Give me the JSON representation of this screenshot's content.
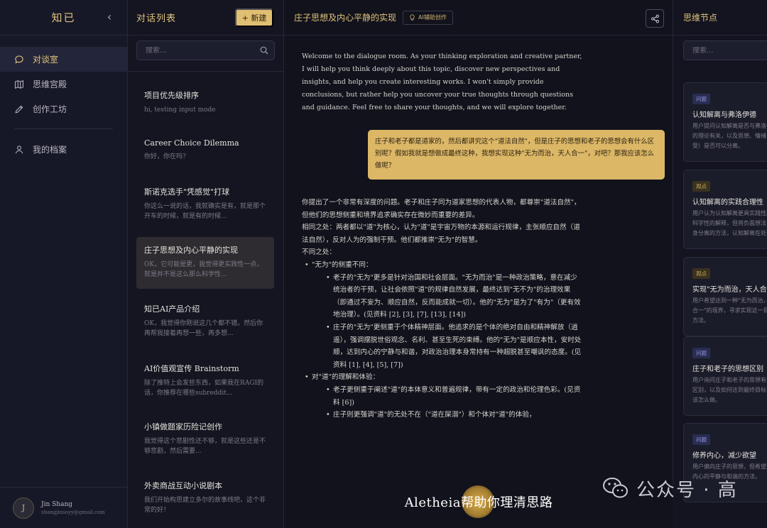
{
  "sidebar": {
    "brand": "知已",
    "items": [
      {
        "label": "对谈室",
        "icon": "chat-bubble-icon"
      },
      {
        "label": "思维宫殿",
        "icon": "map-icon"
      },
      {
        "label": "创作工坊",
        "icon": "pencil-icon"
      },
      {
        "label": "我的档案",
        "icon": "user-icon"
      }
    ],
    "user": {
      "name": "Jin Shang",
      "email": "shangjinsoyy@gmail.com",
      "initial": "J"
    }
  },
  "conversations": {
    "title": "对话列表",
    "new_label": "+ 新建",
    "search_placeholder": "搜索...",
    "items": [
      {
        "title": "项目优先级排序",
        "snippet": "hi, testing input mode"
      },
      {
        "title": "Career Choice Dilemma",
        "snippet": "你好，你在吗?"
      },
      {
        "title": "斯诺克选手\"凭感觉\"打球",
        "snippet": "你这么一说的话，我就确实是有，就是那个开车的时候，就是有的时候..."
      },
      {
        "title": "庄子思想及内心平静的实现",
        "snippet": "OK，它可能是更，我觉得更实践性一点，就是并不是这么那么科学性..."
      },
      {
        "title": "知已AI产品介绍",
        "snippet": "OK，我觉得你刚说这几个都不错。然后你再帮我接着再想一些，再多想..."
      },
      {
        "title": "AI价值观宣传 Brainstorm",
        "snippet": "除了推特上会发些东西，如果我在RAGI的话，你推荐在哪些subreddit..."
      },
      {
        "title": "小镇做题家历险记创作",
        "snippet": "我觉得这个悲剧性还不够，就是这些还是不够悲剧，然后需要..."
      },
      {
        "title": "外卖商战互动小说剧本",
        "snippet": "我们开始构思建立多尔的故事线吧，这个非常的好！"
      }
    ]
  },
  "chat": {
    "title": "庄子思想及内心平静的实现",
    "badge": "AI辅助创作",
    "welcome": "Welcome to the dialogue room. As your thinking exploration and creative partner, I will help you think deeply about this topic, discover new perspectives and insights, and help you create interesting works. I won't simply provide conclusions, but rather help you uncover your true thoughts through questions and guidance. Feel free to share your thoughts, and we will explore together.",
    "user_message": "庄子和老子都是道家的，然后都讲究这个\"道法自然\"，但是庄子的思想和老子的思想会有什么区别呢？假如我就是想做成最终这种，我想实现这种\"无为而治，天人合一\"，对吧？那我应该怎么做呢？",
    "reply": {
      "intro": "你提出了一个非常有深度的问题。老子和庄子同为道家思想的代表人物，都尊崇\"道法自然\"，但他们的思想侧重和境界追求确实存在微妙而重要的差异。",
      "same": "相同之处：两者都以\"道\"为核心，认为\"道\"是宇宙万物的本源和运行规律，主张顺应自然（道法自然），反对人为的强制干预。他们都推崇\"无为\"的智慧。",
      "diff_heading": "不同之处：",
      "b1_title": "\"无为\"的侧重不同：",
      "b1_laozi": "老子的\"无为\"更多是针对治国和社会层面。\"无为而治\"是一种政治策略，意在减少统治者的干预，让社会依照\"道\"的规律自然发展，最终达到\"无不为\"的治理效果（即通过不妄为、顺应自然，反而能成就一切）。他的\"无为\"是为了\"有为\"（更有效地治理）。(见资料 [2], [3], [7], [13], [14])",
      "b1_zhuangzi": "庄子的\"无为\"更侧重于个体精神层面。他追求的是个体的绝对自由和精神解放（逍遥），强调摆脱世俗观念、名利、甚至生死的束缚。他的\"无为\"是顺应本性，安时处顺，达到内心的宁静与和谐，对政治治理本身常持有一种超脱甚至嘲讽的态度。(见资料 [1], [4], [5], [7])",
      "b2_title": "对\"道\"的理解和体验：",
      "b2_laozi": "老子更侧重于阐述\"道\"的本体意义和普遍规律，带有一定的政治和伦理色彩。(见资料 [6])",
      "b2_zhuangzi": "庄子则更强调\"道\"的无处不在（\"道在屎溺\"）和个体对\"道\"的体验，"
    },
    "caption": "Aletheia帮助你理清思路"
  },
  "nodes": {
    "title": "思维节点",
    "search_placeholder": "搜索...",
    "items": [
      {
        "tag": "问题",
        "title": "认知解离与弗洛伊德",
        "text": "用户提问认知解离是否与弗洛伊德的理论有关，以及思想、情绪（感受）是否可以分离。"
      },
      {
        "tag": "观点",
        "title": "认知解离的实践合理性",
        "text": "用户认为认知解离更具实践性而非科学性的解释，但将负面想法与自身分离的方法，认知解离在处理负面想法上有用。"
      },
      {
        "tag": "观点",
        "title": "实现\"无为而治，天人合一\"",
        "text": "用户希望达到一种\"无为而治，天人合一\"的境界，寻求实现这一目标的方法。"
      },
      {
        "tag": "问题",
        "title": "庄子和老子的思想区别",
        "text": "用户询问庄子和老子的思想有什么区别，以及如何达到最终目标，应该怎么做。"
      },
      {
        "tag": "问题",
        "title": "修养内心，减少欲望",
        "text": "用户偏向庄子的思想，但希望达到内心的平静与和谐的方法。"
      }
    ]
  },
  "watermark": {
    "text": "公众号 · 高"
  }
}
